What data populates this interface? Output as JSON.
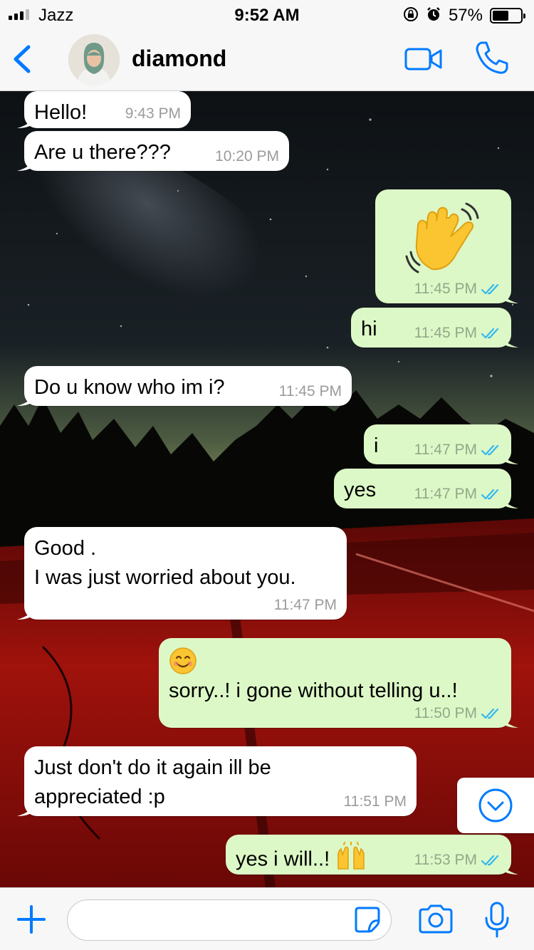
{
  "status_bar": {
    "carrier": "Jazz",
    "time": "9:52 AM",
    "battery": "57%",
    "battery_level": 0.57,
    "icons": [
      "signal-icon",
      "rotation-lock-icon",
      "alarm-icon",
      "battery-icon"
    ]
  },
  "header": {
    "back_icon": "chevron-left-icon",
    "contact_name": "diamond",
    "video_icon": "video-camera-icon",
    "call_icon": "phone-icon",
    "accent_color": "#007aff"
  },
  "colors": {
    "incoming_bubble": "#ffffff",
    "outgoing_bubble": "#dcf8c6",
    "read_ticks": "#34b7f1"
  },
  "messages": [
    {
      "dir": "in",
      "text": "Hello!",
      "time": "9:43 PM"
    },
    {
      "dir": "in",
      "text": "Are u there???",
      "time": "10:20 PM"
    },
    {
      "dir": "out",
      "emoji": "waving-hand",
      "time": "11:45 PM",
      "read": true
    },
    {
      "dir": "out",
      "text": "hi",
      "time": "11:45 PM",
      "read": true
    },
    {
      "dir": "in",
      "text": "Do u know who im i?",
      "time": "11:45 PM"
    },
    {
      "dir": "out",
      "text": "i",
      "time": "11:47 PM",
      "read": true
    },
    {
      "dir": "out",
      "text": "yes",
      "time": "11:47 PM",
      "read": true
    },
    {
      "dir": "in",
      "lines": [
        "Good .",
        "I was just worried about you."
      ],
      "time": "11:47 PM"
    },
    {
      "dir": "out",
      "emoji_prefix": "smiling-face",
      "text": "sorry..! i gone without telling u..!",
      "time": "11:50 PM",
      "read": true
    },
    {
      "dir": "in",
      "lines": [
        "Just don't do it again ill be",
        "appreciated :p"
      ],
      "time": "11:51 PM"
    },
    {
      "dir": "out",
      "text": "yes i will..!",
      "emoji_suffix": "raising-hands",
      "time": "11:53 PM",
      "read": true
    }
  ],
  "scroll_button": {
    "icon": "chevron-down-circle-icon"
  },
  "input_bar": {
    "plus_icon": "plus-icon",
    "placeholder": "",
    "value": "",
    "sticker_icon": "sticker-icon",
    "camera_icon": "camera-icon",
    "mic_icon": "microphone-icon"
  }
}
